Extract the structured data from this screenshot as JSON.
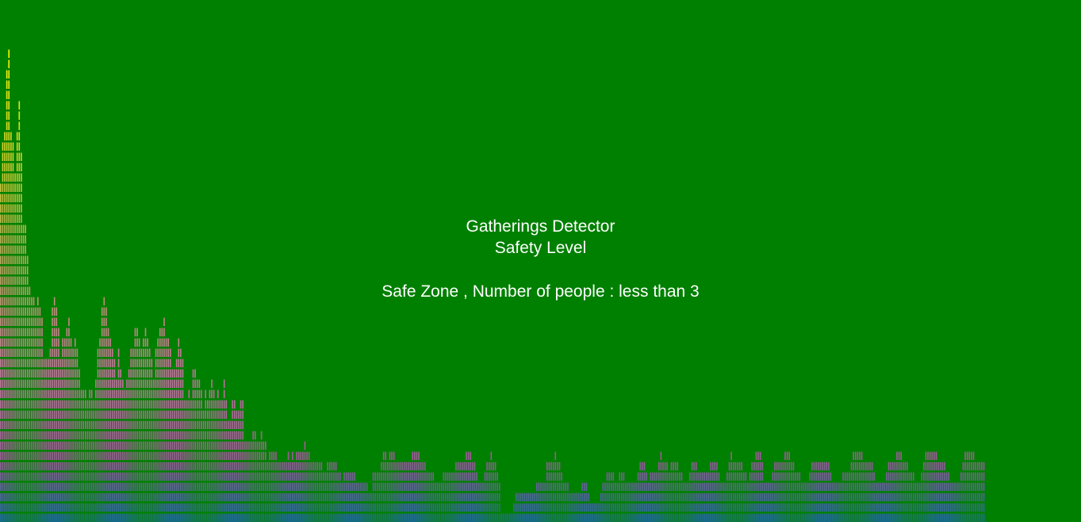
{
  "app": {
    "title": "Gatherings Detector",
    "subtitle": "Safety Level",
    "status": "Safe Zone , Number of people : less than 3"
  },
  "colors": {
    "background": "#008000",
    "text": "#ffffff",
    "gradient_top": "#ffff00",
    "gradient_mid": "#c0609c",
    "gradient_bottom": "#1060a0"
  },
  "visualizer": {
    "type": "frequency-bars",
    "max_segments": 46,
    "levels": [
      33,
      37,
      38,
      44,
      46,
      38,
      37,
      34,
      38,
      41,
      36,
      29,
      29,
      26,
      23,
      22,
      22,
      21,
      22,
      21,
      20,
      16,
      16,
      16,
      17,
      21,
      22,
      21,
      19,
      16,
      18,
      18,
      19,
      20,
      18,
      17,
      18,
      17,
      15,
      13,
      13,
      13,
      12,
      13,
      13,
      12,
      14,
      17,
      18,
      21,
      22,
      21,
      19,
      18,
      17,
      16,
      14,
      17,
      15,
      14,
      13,
      14,
      15,
      17,
      17,
      19,
      19,
      18,
      17,
      18,
      19,
      18,
      17,
      16,
      14,
      17,
      18,
      19,
      19,
      20,
      18,
      18,
      17,
      15,
      15,
      16,
      18,
      17,
      16,
      12,
      12,
      13,
      12,
      15,
      15,
      14,
      14,
      13,
      11,
      13,
      12,
      13,
      14,
      13,
      12,
      13,
      12,
      12,
      14,
      12,
      10,
      10,
      12,
      12,
      11,
      11,
      12,
      12,
      8,
      8,
      8,
      8,
      9,
      9,
      8,
      8,
      9,
      8,
      8,
      6,
      7,
      7,
      7,
      7,
      6,
      6,
      6,
      6,
      6,
      7,
      6,
      7,
      6,
      7,
      7,
      7,
      7,
      8,
      7,
      7,
      6,
      6,
      6,
      6,
      6,
      6,
      5,
      5,
      6,
      6,
      6,
      6,
      6,
      5,
      5,
      4,
      5,
      5,
      5,
      5,
      5,
      5,
      4,
      4,
      4,
      4,
      4,
      4,
      3,
      3,
      5,
      5,
      5,
      5,
      6,
      7,
      7,
      6,
      7,
      7,
      7,
      6,
      6,
      6,
      6,
      6,
      6,
      6,
      6,
      7,
      7,
      7,
      7,
      6,
      6,
      6,
      5,
      5,
      5,
      5,
      4,
      4,
      4,
      4,
      5,
      5,
      5,
      5,
      5,
      5,
      6,
      6,
      6,
      6,
      6,
      7,
      7,
      7,
      6,
      6,
      5,
      4,
      4,
      4,
      5,
      6,
      6,
      7,
      6,
      6,
      5,
      4,
      1,
      1,
      1,
      1,
      1,
      1,
      2,
      3,
      3,
      3,
      3,
      3,
      3,
      3,
      3,
      3,
      3,
      4,
      4,
      4,
      4,
      4,
      6,
      6,
      6,
      6,
      7,
      6,
      6,
      5,
      4,
      4,
      4,
      3,
      3,
      3,
      3,
      3,
      3,
      4,
      4,
      4,
      3,
      2,
      2,
      2,
      2,
      2,
      3,
      4,
      4,
      5,
      5,
      5,
      5,
      4,
      4,
      5,
      5,
      5,
      4,
      4,
      4,
      4,
      4,
      4,
      5,
      6,
      6,
      6,
      5,
      4,
      5,
      5,
      5,
      5,
      6,
      7,
      6,
      6,
      6,
      5,
      6,
      6,
      6,
      6,
      5,
      5,
      4,
      4,
      4,
      5,
      6,
      6,
      6,
      5,
      5,
      5,
      5,
      5,
      5,
      6,
      6,
      6,
      6,
      5,
      4,
      4,
      4,
      5,
      6,
      7,
      6,
      6,
      6,
      6,
      6,
      5,
      5,
      4,
      5,
      6,
      6,
      7,
      7,
      7,
      6,
      4,
      4,
      4,
      4,
      5,
      6,
      6,
      6,
      6,
      6,
      7,
      7,
      7,
      6,
      6,
      5,
      5,
      5,
      4,
      4,
      4,
      4,
      5,
      6,
      6,
      6,
      6,
      6,
      6,
      6,
      6,
      6,
      5,
      4,
      4,
      4,
      4,
      4,
      5,
      5,
      5,
      5,
      6,
      7,
      7,
      7,
      7,
      7,
      6,
      6,
      6,
      6,
      6,
      5,
      4,
      4,
      4,
      4,
      4,
      5,
      6,
      6,
      6,
      6,
      7,
      7,
      7,
      6,
      6,
      6,
      5,
      5,
      5,
      4,
      4,
      4,
      5,
      6,
      7,
      7,
      7,
      7,
      7,
      7,
      6,
      6,
      6,
      6,
      5,
      5,
      4,
      4,
      4,
      4,
      4,
      5,
      6,
      7,
      7,
      7,
      7,
      7,
      6,
      6,
      6,
      6,
      6
    ]
  }
}
